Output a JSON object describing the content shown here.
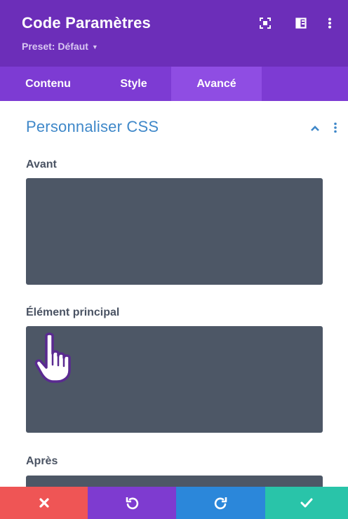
{
  "header": {
    "title": "Code Paramètres",
    "preset_label": "Preset: Défaut",
    "icons": [
      "fullscreen-icon",
      "split-view-icon",
      "more-options-icon"
    ],
    "color": "#6c2eb9"
  },
  "tabs": [
    {
      "label": "Contenu",
      "active": false
    },
    {
      "label": "Style",
      "active": false
    },
    {
      "label": "Avancé",
      "active": true
    }
  ],
  "section": {
    "title": "Personnaliser CSS",
    "expanded": true,
    "title_color": "#3f88c9"
  },
  "fields": [
    {
      "label": "Avant",
      "value": ""
    },
    {
      "label": "Élément principal",
      "value": ""
    },
    {
      "label": "Après",
      "value": ""
    }
  ],
  "footer": {
    "buttons": [
      {
        "name": "cancel",
        "icon": "close-icon",
        "color": "#ef5555"
      },
      {
        "name": "undo",
        "icon": "undo-icon",
        "color": "#7e3bd0"
      },
      {
        "name": "redo",
        "icon": "redo-icon",
        "color": "#2b87da"
      },
      {
        "name": "save",
        "icon": "checkmark-icon",
        "color": "#29c4a9"
      }
    ]
  }
}
